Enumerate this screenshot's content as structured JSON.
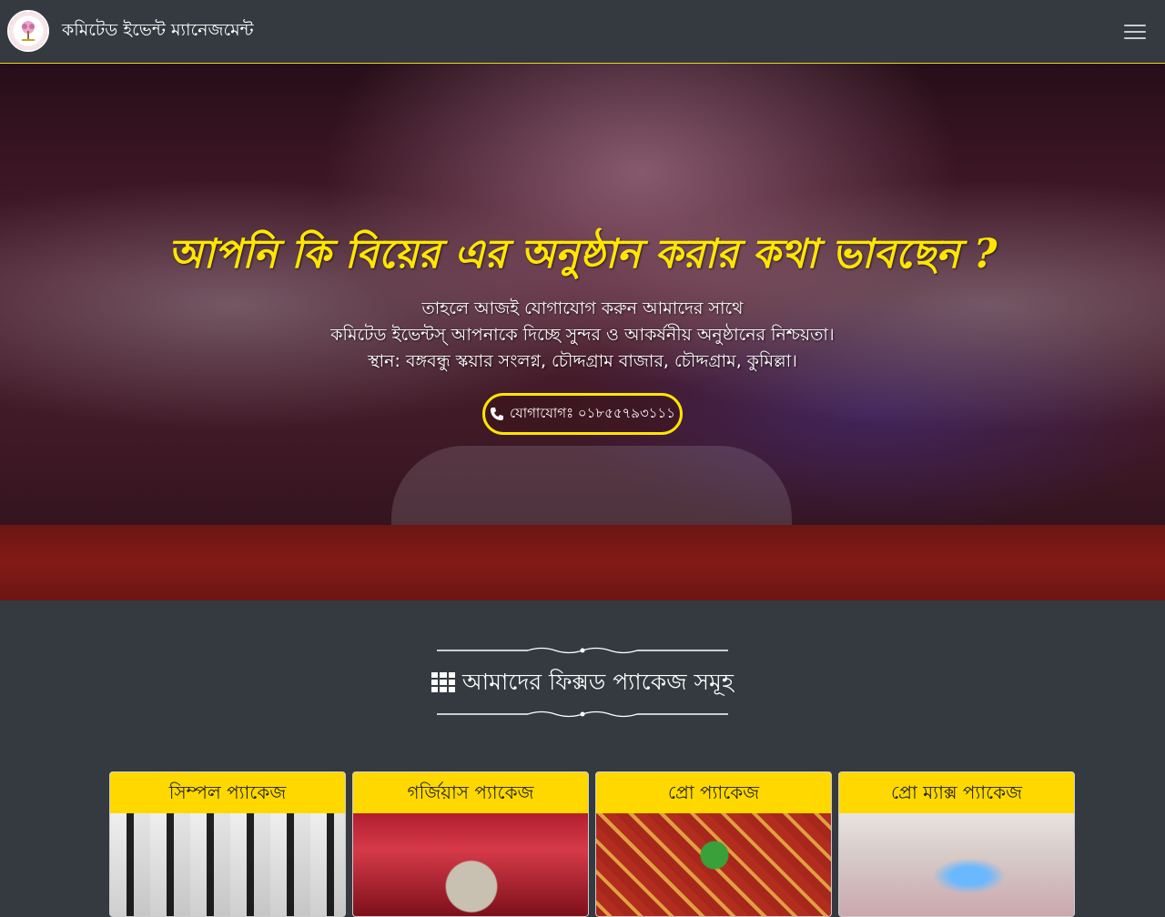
{
  "navbar": {
    "brand": "কমিটেড ইভেন্ট ম্যানেজমেন্ট",
    "logo_icon": "logo-tree-icon",
    "toggler_icon": "hamburger-menu-icon"
  },
  "hero": {
    "title": "আপনি কি বিয়ের এর অনুষ্ঠান করার কথা ভাবছেন ?",
    "line1": "তাহলে আজই যোগাযোগ করুন আমাদের সাথে",
    "line2": "কমিটেড ইভেন্টস্ আপনাকে দিচ্ছে সুন্দর ও আকর্ষনীয় অনুষ্ঠানের নিশ্চয়তা।",
    "line3": "স্থান: বঙ্গবন্ধু স্কয়ার সংলগ্ন, চৌদ্দগ্রাম বাজার, চৌদ্দগ্রাম, কুমিল্লা।",
    "call_button": "যোগাযোগঃ ০১৮৫৫৭৯৩১১১",
    "call_icon": "phone-icon",
    "title_color": "#ffe600"
  },
  "section": {
    "title": "আমাদের ফিক্সড প্যাকেজ সমূহ",
    "title_icon": "grid-icon"
  },
  "packages": [
    {
      "name": "সিম্পল প্যাকেজ"
    },
    {
      "name": "গর্জিয়াস প্যাকেজ"
    },
    {
      "name": "প্রো প্যাকেজ"
    },
    {
      "name": "প্রো ম্যাক্স প্যাকেজ"
    }
  ],
  "colors": {
    "navbar_bg": "#343a40",
    "accent": "#ffd800"
  }
}
